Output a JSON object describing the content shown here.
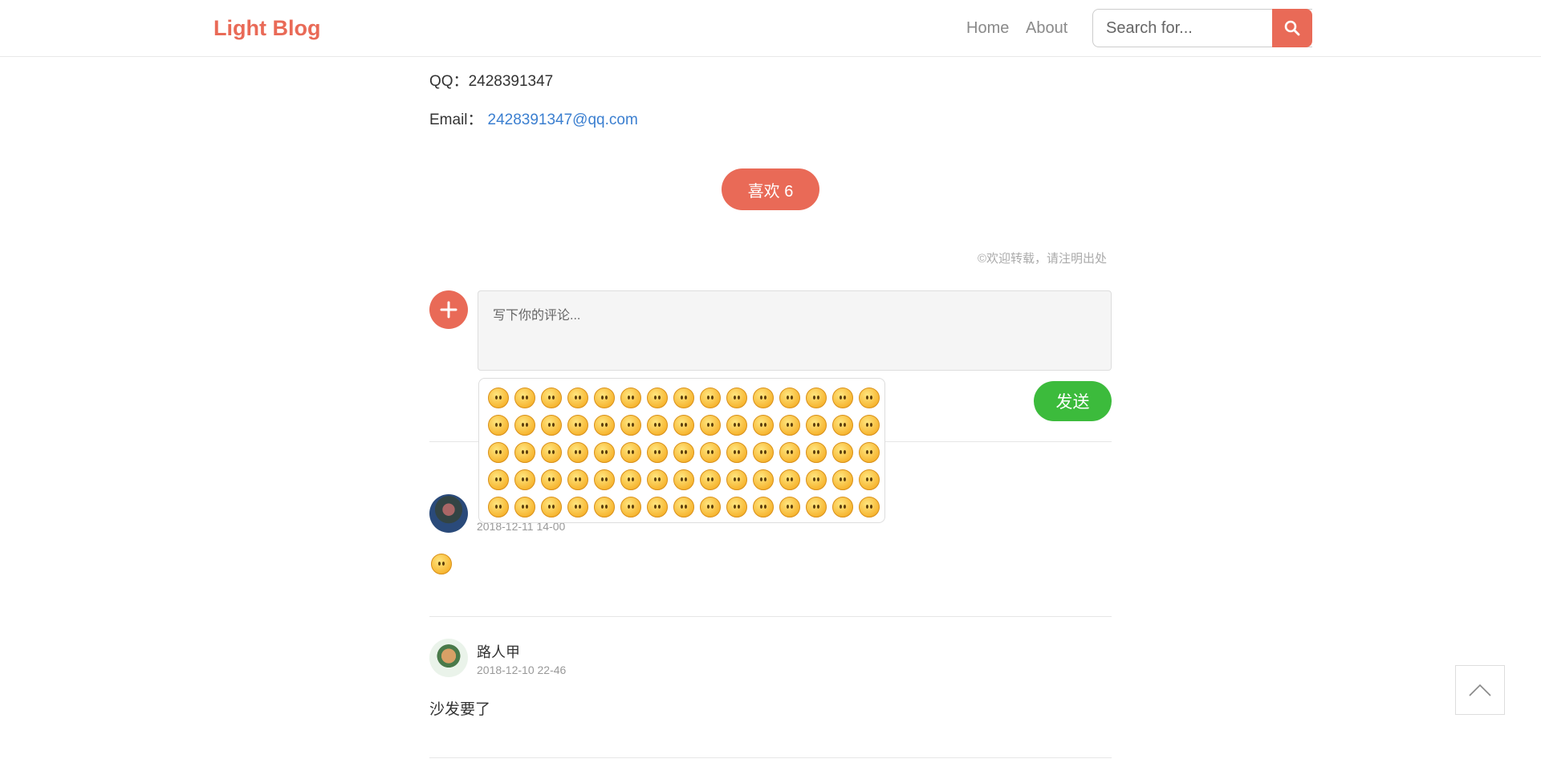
{
  "nav": {
    "brand": "Light Blog",
    "home": "Home",
    "about": "About",
    "search_placeholder": "Search for..."
  },
  "contact": {
    "qq_label": "QQ：",
    "qq_value": "2428391347",
    "email_label": "Email：",
    "email_value": "2428391347@qq.com"
  },
  "like_button": "喜欢 6",
  "copyright": "©欢迎转载，请注明出处",
  "comment_form": {
    "placeholder": "写下你的评论...",
    "send": "发送"
  },
  "emoji_panel": {
    "count": 75
  },
  "comments": [
    {
      "name": "",
      "time": "2018-12-11 14-00",
      "body_icon": "smiley-emoji-icon"
    },
    {
      "name": "路人甲",
      "time": "2018-12-10 22-46",
      "body": "沙发要了"
    }
  ],
  "colors": {
    "accent": "#e96a57",
    "send": "#3cbb3c",
    "link": "#3b7fd0"
  }
}
